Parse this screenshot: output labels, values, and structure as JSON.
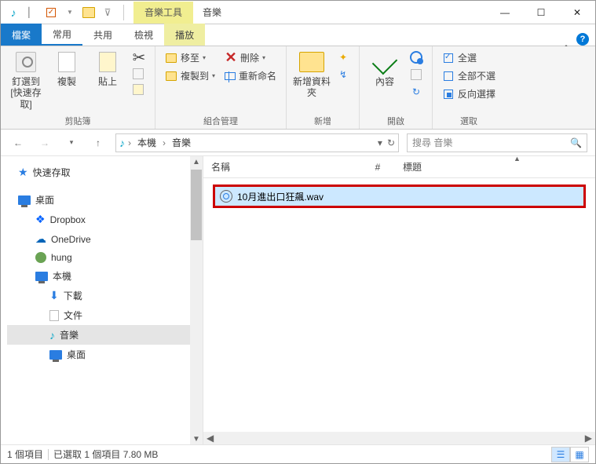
{
  "titlebar": {
    "contextual_tab": "音樂工具",
    "title": "音樂"
  },
  "tabs": {
    "file": "檔案",
    "home": "常用",
    "share": "共用",
    "view": "檢視",
    "play": "播放"
  },
  "ribbon": {
    "clipboard": {
      "pin": "釘選到 [快速存取]",
      "copy": "複製",
      "paste": "貼上",
      "label": "剪貼簿"
    },
    "organize": {
      "moveto": "移至",
      "delete": "刪除",
      "copyto": "複製到",
      "rename": "重新命名",
      "label": "組合管理"
    },
    "new": {
      "newfolder": "新增資料夾",
      "label": "新增"
    },
    "open": {
      "properties": "內容",
      "label": "開啟"
    },
    "select": {
      "selectall": "全選",
      "selectnone": "全部不選",
      "invert": "反向選擇",
      "label": "選取"
    }
  },
  "nav": {
    "bc1": "本機",
    "bc2": "音樂",
    "search_placeholder": "搜尋 音樂"
  },
  "tree": {
    "quick": "快速存取",
    "desktop": "桌面",
    "dropbox": "Dropbox",
    "onedrive": "OneDrive",
    "hung": "hung",
    "thispc": "本機",
    "downloads": "下載",
    "documents": "文件",
    "music": "音樂",
    "desktop2": "桌面"
  },
  "columns": {
    "name": "名稱",
    "hash": "#",
    "title": "標題"
  },
  "file": {
    "name": "10月進出口狂飆.wav"
  },
  "status": {
    "items": "1 個項目",
    "selected": "已選取 1 個項目 7.80 MB"
  }
}
